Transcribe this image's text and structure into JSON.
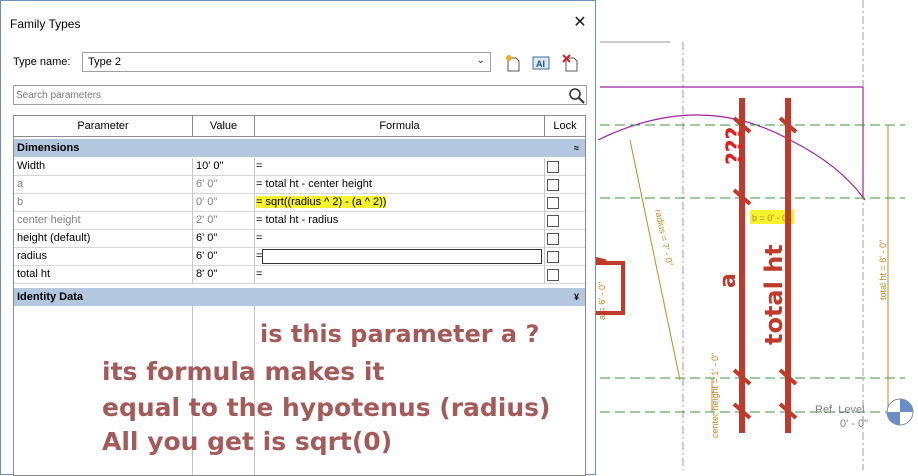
{
  "dialog": {
    "title": "Family Types",
    "close_glyph": "✕",
    "type_name_label": "Type name:",
    "type_name_value": "Type 2",
    "search_placeholder": "Search parameters",
    "toolbar_icons": [
      "new-type-icon",
      "rename-type-icon",
      "delete-type-icon"
    ]
  },
  "table": {
    "headers": [
      "Parameter",
      "Value",
      "Formula",
      "Lock"
    ],
    "groups": [
      {
        "name": "Dimensions",
        "chevron": "≈"
      },
      {
        "name": "Identity Data",
        "chevron": "¥"
      }
    ],
    "rows": [
      {
        "name": "Width",
        "value": "10'  0\"",
        "formula": "=",
        "dim": false
      },
      {
        "name": "a",
        "value": "6'  0\"",
        "formula": "= total ht - center height",
        "dim": true
      },
      {
        "name": "b",
        "value": "0'  0\"",
        "formula": "= sqrt((radius ^ 2) - (a ^ 2))",
        "dim": true
      },
      {
        "name": "center height",
        "value": "2'  0\"",
        "formula": "= total ht - radius",
        "dim": true
      },
      {
        "name": "height (default)",
        "value": "6'  0\"",
        "formula": "=",
        "dim": false
      },
      {
        "name": "radius",
        "value": "6'  0\"",
        "formula": "=",
        "dim": false
      },
      {
        "name": "total ht",
        "value": "8'  0\"",
        "formula": "=",
        "dim": false
      }
    ]
  },
  "annotations": {
    "question": "is this parameter a ?",
    "line1": "its formula makes it",
    "line2": "equal to the hypotenus (radius)",
    "line3": "All you get is sqrt(0)",
    "marks": "???",
    "label_a": "a",
    "label_total": "total ht"
  },
  "drawing": {
    "radius_dim": "radius = 7' - 0\"",
    "a_dim": "a = 6' - 0\"",
    "b_dim": "b = 0' - 0\"",
    "total_dim": "total ht = 8' - 0\"",
    "center_dim": "center height = 1' - 0\"",
    "ref_level": "Ref. Level",
    "ref_value": "0' - 0\""
  },
  "colors": {
    "accent_red": "#c0392b",
    "annotation_text": "#a55a5a",
    "dim_orange": "#c8861e",
    "group_header": "#b3c8de",
    "highlight": "#f5f22e"
  }
}
